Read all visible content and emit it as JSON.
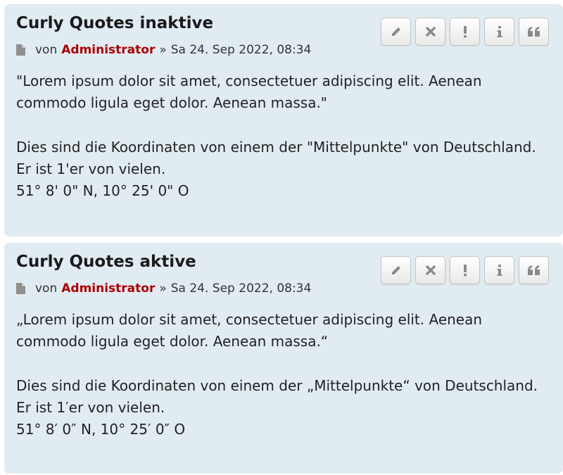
{
  "colors": {
    "post_background": "#e1ebf2",
    "author_color": "#aa0000",
    "text_color": "#222222"
  },
  "icons": {
    "post_icon": "document-icon",
    "edit": "pencil-icon",
    "delete": "close-icon",
    "report": "exclamation-icon",
    "info": "info-icon",
    "quote": "quote-icon"
  },
  "posts": [
    {
      "title": "Curly Quotes inaktive",
      "meta": {
        "by": "von",
        "author": "Administrator",
        "separator": "»",
        "date": "Sa 24. Sep 2022, 08:34"
      },
      "paragraph1_line1": "\"Lorem ipsum dolor sit amet, consectetuer adipiscing elit. Aenean",
      "paragraph1_line2": "commodo ligula eget dolor. Aenean massa.\"",
      "paragraph2_line1": "Dies sind die Koordinaten von einem der \"Mittelpunkte\" von Deutschland.",
      "paragraph2_line2": "Er ist 1'er von vielen.",
      "paragraph2_line3": "51° 8' 0\" N, 10° 25' 0\" O"
    },
    {
      "title": "Curly Quotes aktive",
      "meta": {
        "by": "von",
        "author": "Administrator",
        "separator": "»",
        "date": "Sa 24. Sep 2022, 08:34"
      },
      "paragraph1_line1": "„Lorem ipsum dolor sit amet, consectetuer adipiscing elit. Aenean",
      "paragraph1_line2": "commodo ligula eget dolor. Aenean massa.“",
      "paragraph2_line1": "Dies sind die Koordinaten von einem der „Mittelpunkte“ von Deutschland.",
      "paragraph2_line2": "Er ist 1′er von vielen.",
      "paragraph2_line3": "51° 8′ 0″ N, 10° 25′ 0″ O"
    }
  ]
}
